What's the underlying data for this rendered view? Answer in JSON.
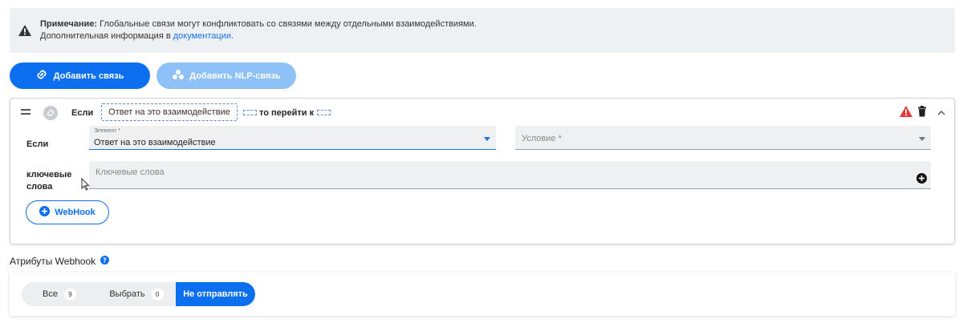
{
  "note": {
    "bold": "Примечание:",
    "text": " Глобальные связи могут конфликтовать со связями между отдельными взаимодействиями.",
    "line2": "Дополнительная информация в ",
    "link": "документации."
  },
  "toolbar": {
    "add_link_label": "Добавить связь",
    "add_nlp_label": "Добавить NLP-связь"
  },
  "rule": {
    "header": {
      "if_label": "Если",
      "chip_text": "Ответ на это взаимодействие",
      "goto_label": "то перейти к"
    },
    "row_if_label": "Если",
    "element_field": {
      "label": "Элемент *",
      "value": "Ответ на это взаимодействие"
    },
    "condition_placeholder": "Условие *",
    "keywords_label_1": "ключевые",
    "keywords_label_2": "слова",
    "keywords_placeholder": "Ключевые слова",
    "webhook_label": "WebHook"
  },
  "attributes": {
    "title": "Атрибуты Webhook",
    "segments": [
      {
        "label": "Все",
        "count": "9"
      },
      {
        "label": "Выбрать",
        "count": "0"
      },
      {
        "label": "Не отправлять"
      }
    ]
  },
  "colors": {
    "primary": "#0b6ff0",
    "primary_light": "#8ec1f7",
    "alert": "#e53935"
  }
}
